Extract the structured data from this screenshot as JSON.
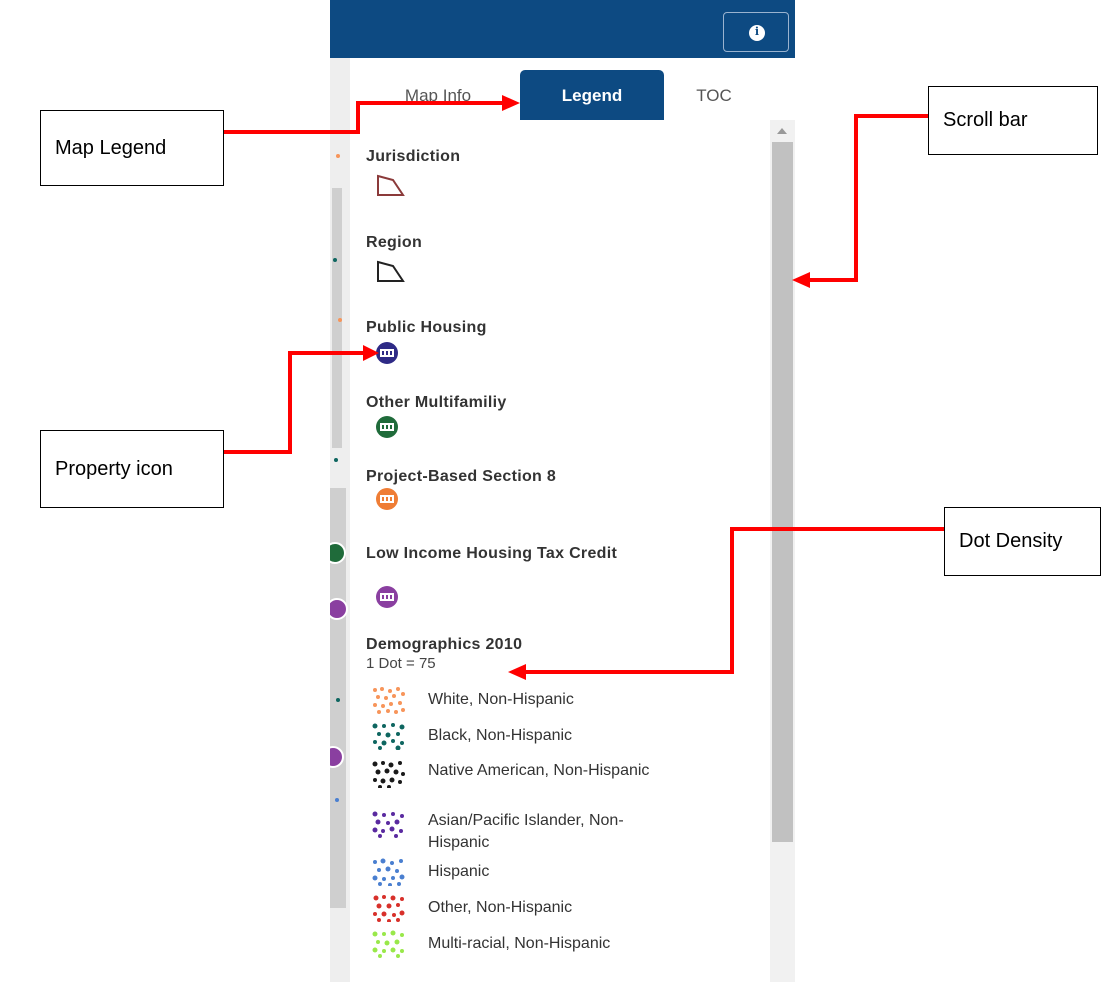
{
  "header": {
    "info_icon": "info-icon"
  },
  "tabs": [
    {
      "label": "Map Info",
      "active": false
    },
    {
      "label": "Legend",
      "active": true
    },
    {
      "label": "TOC",
      "active": false
    }
  ],
  "legend": {
    "jurisdiction": {
      "title": "Jurisdiction",
      "color": "#8b3a3a"
    },
    "region": {
      "title": "Region",
      "color": "#222222"
    },
    "public_housing": {
      "title": "Public Housing",
      "color": "#2e2a86"
    },
    "other_multifamily": {
      "title": "Other Multifamiliy",
      "color": "#1f6b3a"
    },
    "project_based": {
      "title": "Project-Based Section 8",
      "color": "#ef7d35"
    },
    "lihtc": {
      "title": "Low Income Housing Tax Credit",
      "color": "#8a3fa0"
    },
    "demographics": {
      "title": "Demographics 2010",
      "dot_value": "1 Dot = 75",
      "items": [
        {
          "label": "White, Non-Hispanic",
          "color": "#f7955a"
        },
        {
          "label": "Black, Non-Hispanic",
          "color": "#0e6660"
        },
        {
          "label": "Native American, Non-Hispanic",
          "color": "#1a1a1a"
        },
        {
          "label": "Asian/Pacific Islander, Non-Hispanic",
          "color": "#5a2aa0"
        },
        {
          "label": "Hispanic",
          "color": "#4a7fd0"
        },
        {
          "label": "Other, Non-Hispanic",
          "color": "#d8302a"
        },
        {
          "label": "Multi-racial, Non-Hispanic",
          "color": "#99e84a"
        }
      ]
    }
  },
  "callouts": {
    "map_legend": "Map Legend",
    "scroll_bar": "Scroll bar",
    "property_icon": "Property icon",
    "dot_density": "Dot Density"
  },
  "arrow_color": "#ff0000"
}
